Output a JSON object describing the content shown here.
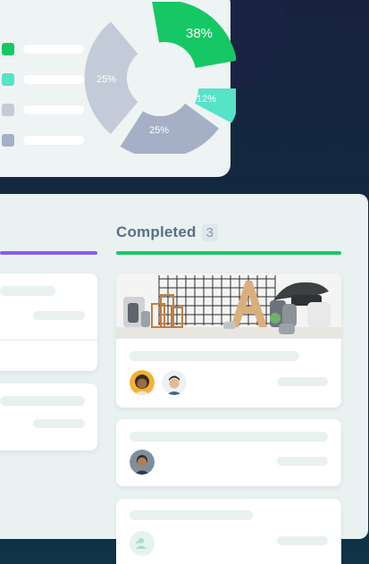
{
  "chart": {
    "segments": [
      {
        "label": "38%",
        "value": 38,
        "color": "#16c865"
      },
      {
        "label": "12%",
        "value": 12,
        "color": "#56e3c7"
      },
      {
        "label": "25%",
        "value": 25,
        "color": "#a5b0c6"
      },
      {
        "label": "25%",
        "value": 25,
        "color": "#c3cbd9"
      }
    ],
    "legend_colors": [
      "#16c865",
      "#56e3c7",
      "#c3cbd9",
      "#a5b0c6"
    ]
  },
  "board": {
    "completed_column": {
      "title": "Completed",
      "count": "3"
    }
  },
  "colors": {
    "in_progress_accent": "#8a5cf0",
    "completed_accent": "#16c865"
  }
}
